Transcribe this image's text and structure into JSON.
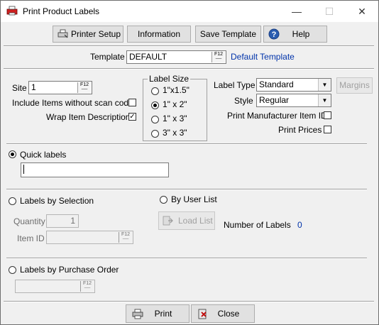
{
  "window": {
    "title": "Print Product Labels",
    "controls": {
      "minimize": "—",
      "maximize": "☐",
      "close": "✕"
    }
  },
  "toolbar": {
    "printer_setup": "Printer Setup",
    "information": "Information",
    "save_template": "Save Template",
    "help": "Help"
  },
  "template": {
    "label": "Template",
    "value": "DEFAULT",
    "description": "Default Template",
    "f12_top": "F12",
    "f12_bottom": "",
    "description_color": "#0033aa"
  },
  "site": {
    "label": "Site",
    "value": "1",
    "f12": "F12"
  },
  "options": {
    "include_no_scan": "Include Items without scan code",
    "include_no_scan_checked": false,
    "wrap_desc": "Wrap Item Description",
    "wrap_desc_checked": true
  },
  "label_size": {
    "title": "Label Size",
    "options": [
      "1\"x1.5\"",
      "1\" x 2\"",
      "1\" x 3\"",
      "3\" x 3\""
    ],
    "selected_index": 1
  },
  "label_type": {
    "label": "Label Type",
    "value": "Standard",
    "margins": "Margins"
  },
  "style": {
    "label": "Style",
    "value": "Regular"
  },
  "print_mfr_id": {
    "label": "Print Manufacturer Item ID",
    "checked": false
  },
  "print_prices": {
    "label": "Print Prices",
    "checked": false
  },
  "quick_labels": {
    "label": "Quick labels",
    "selected": true,
    "value": ""
  },
  "by_selection": {
    "label": "Labels by Selection",
    "quantity_label": "Quantity",
    "quantity_value": "1",
    "item_id_label": "Item ID",
    "item_id_f12": "F12"
  },
  "by_user_list": {
    "label": "By User List",
    "load_list": "Load List",
    "num_labels_label": "Number of Labels",
    "num_labels_value": "0"
  },
  "by_po": {
    "label": "Labels by Purchase Order",
    "f12": "F12"
  },
  "footer": {
    "print": "Print",
    "close": "Close"
  }
}
